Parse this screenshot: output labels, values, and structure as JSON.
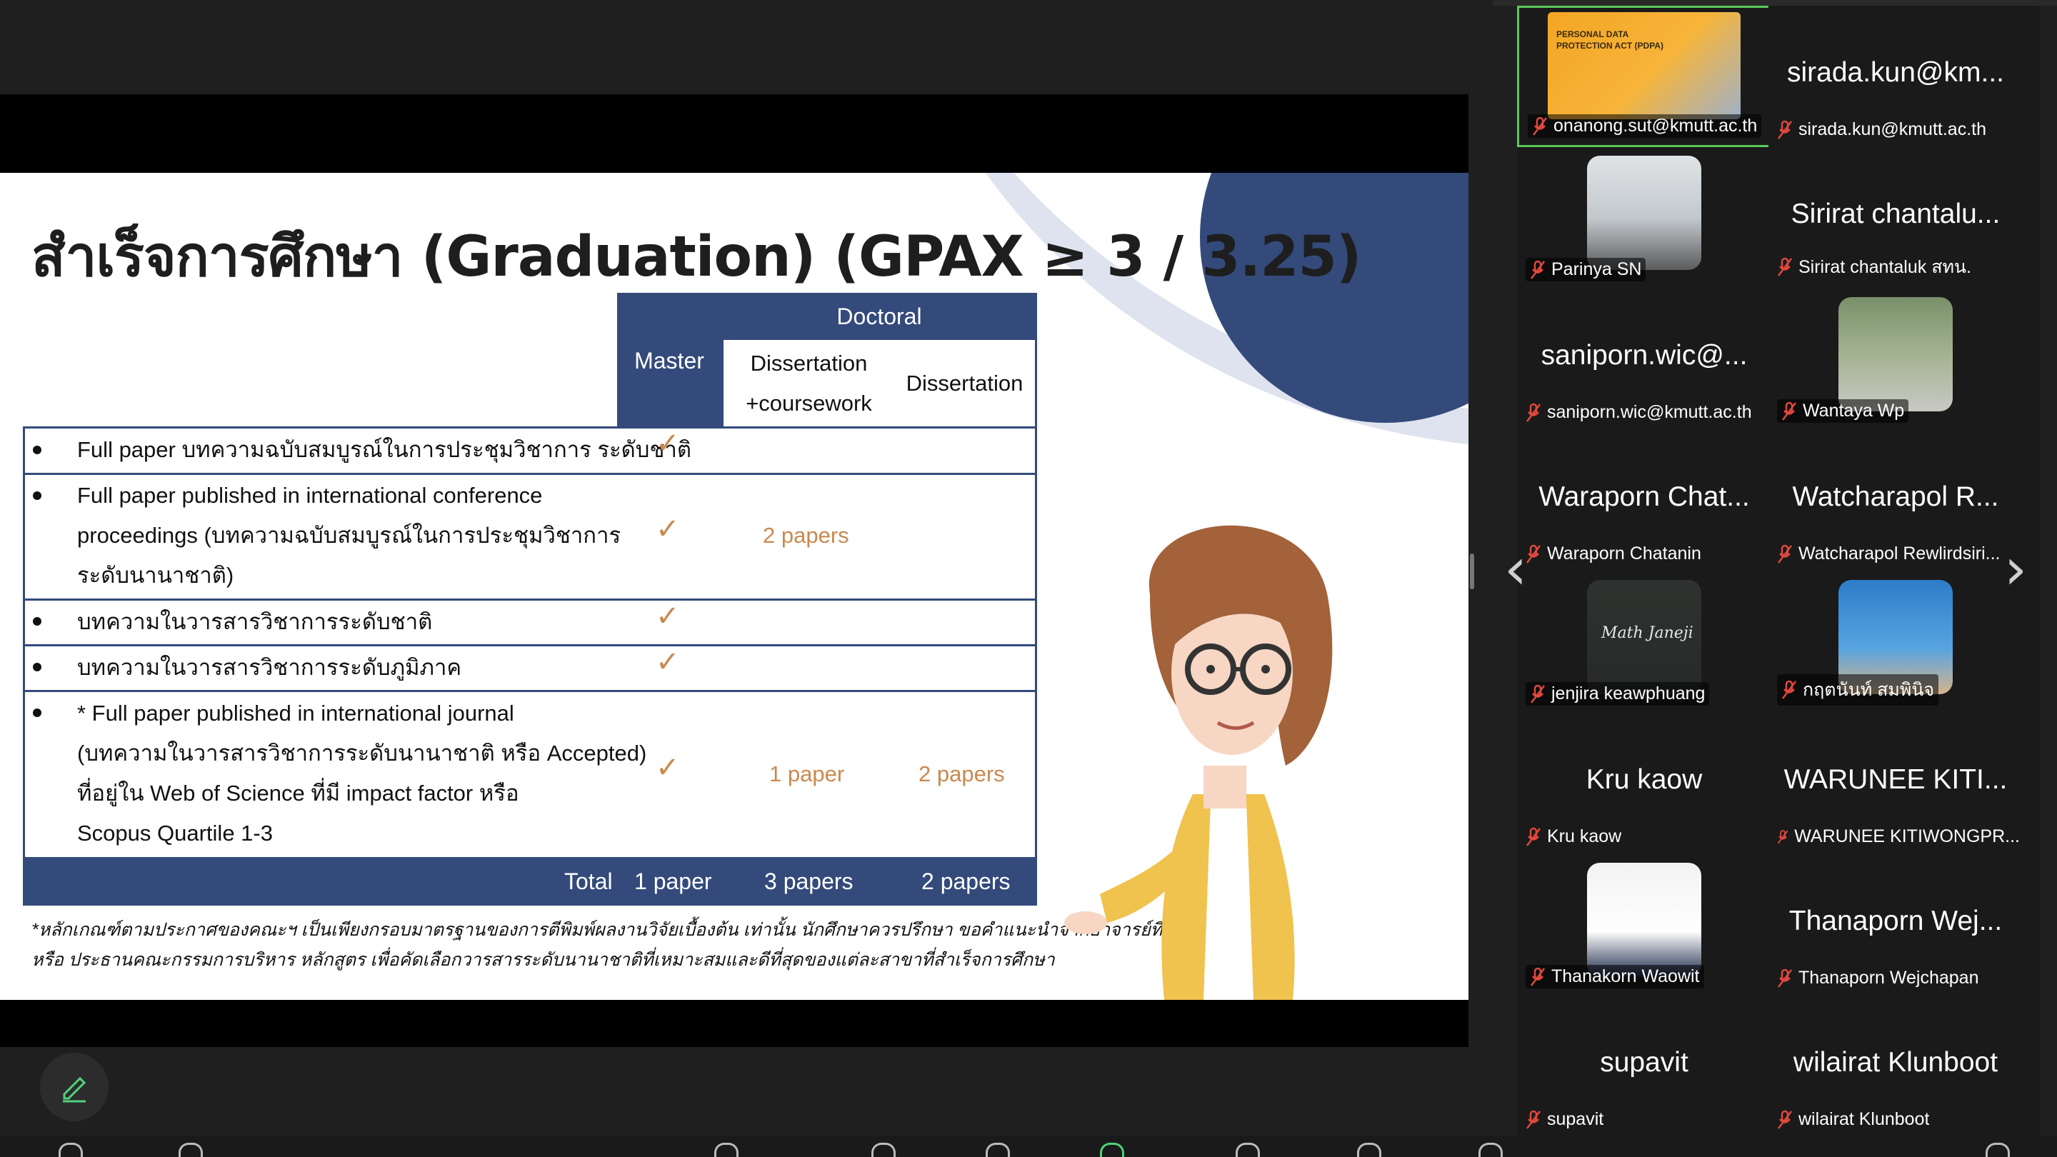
{
  "slide": {
    "title": "สำเร็จการศึกษา (Graduation) (GPAX ≥ 3 / 3.25)",
    "headers": {
      "master": "Master",
      "doctoral": "Doctoral",
      "diss_cw_1": "Dissertation",
      "diss_cw_2": "+coursework",
      "dissertation": "Dissertation"
    },
    "rows": [
      {
        "lines": [
          "Full paper บทความฉบับสมบูรณ์ในการประชุมวิชาการ ระดับชาติ"
        ],
        "master": "✓",
        "diss_cw": "",
        "diss": ""
      },
      {
        "lines": [
          "Full paper published in international conference",
          "proceedings (บทความฉบับสมบูรณ์ในการประชุมวิชาการ",
          "ระดับนานาชาติ)"
        ],
        "master": "✓",
        "diss_cw": "2 papers",
        "diss": ""
      },
      {
        "lines": [
          "บทความในวารสารวิชาการระดับชาติ"
        ],
        "master": "✓",
        "diss_cw": "",
        "diss": ""
      },
      {
        "lines": [
          "บทความในวารสารวิชาการระดับภูมิภาค"
        ],
        "master": "✓",
        "diss_cw": "",
        "diss": ""
      },
      {
        "lines": [
          "* Full paper published in international journal",
          "(บทความในวารสารวิชาการระดับนานาชาติ หรือ Accepted)",
          "ที่อยู่ใน Web of Science ที่มี impact factor หรือ",
          "Scopus Quartile 1-3"
        ],
        "master": "✓",
        "diss_cw": "1 paper",
        "diss": "2  papers"
      }
    ],
    "totals": {
      "label": "Total",
      "master": "1 paper",
      "diss_cw": "3 papers",
      "diss": "2 papers"
    },
    "footnote": [
      "*หลักเกณฑ์ตามประกาศของคณะฯ เป็นเพียงกรอบมาตรฐานของการตีพิมพ์ผลงานวิจัยเบื้องต้น เท่านั้น นักศึกษาควรปรึกษา ขอคำแนะนำจากอาจารย์ที่ปรึกษาฯ และ/",
      "หรือ ประธานคณะกรรมการบริหาร หลักสูตร เพื่อคัดเลือกวารสารระดับนานาชาติที่เหมาะสมและดีที่สุดของแต่ละสาขาที่สำเร็จการศึกษา"
    ]
  },
  "participants": [
    {
      "name": "",
      "label": "onanong.sut@kmutt.ac.th",
      "avatar": "pdpa-poster",
      "active": true,
      "poster_lines": [
        "PERSONAL DATA",
        "PROTECTION ACT (PDPA)"
      ]
    },
    {
      "name": "sirada.kun@km...",
      "label": "sirada.kun@kmutt.ac.th"
    },
    {
      "name": "",
      "label": "Parinya SN",
      "avatar": "photo-building"
    },
    {
      "name": "Sirirat chantalu...",
      "label": "Sirirat chantaluk สทน."
    },
    {
      "name": "saniporn.wic@...",
      "label": "saniporn.wic@kmutt.ac.th"
    },
    {
      "name": "",
      "label": "Wantaya Wp",
      "avatar": "photo-outdoor"
    },
    {
      "name": "Waraporn Chat...",
      "label": "Waraporn Chatanin"
    },
    {
      "name": "Watcharapol R...",
      "label": "Watcharapol Rewlirdsiri..."
    },
    {
      "name": "",
      "label": "jenjira keawphuang",
      "avatar": "math-chalk",
      "avatar_text": "Math Janeji"
    },
    {
      "name": "",
      "label": "กฤตนันท์ สมพินิจ",
      "avatar": "photo-blue"
    },
    {
      "name": "Kru kaow",
      "label": "Kru kaow"
    },
    {
      "name": "WARUNEE KITI...",
      "label": "WARUNEE KITIWONGPR..."
    },
    {
      "name": "",
      "label": "Thanakorn Waowit",
      "avatar": "photo-portrait"
    },
    {
      "name": "Thanaporn Wej...",
      "label": "Thanaporn Wejchapan"
    },
    {
      "name": "supavit",
      "label": "supavit"
    },
    {
      "name": "wilairat Klunboot",
      "label": "wilairat Klunboot"
    }
  ],
  "colors": {
    "table_header": "#334a7b",
    "check": "#c9894f",
    "active_border": "#58c85a",
    "muted_mic": "#e0483e"
  }
}
